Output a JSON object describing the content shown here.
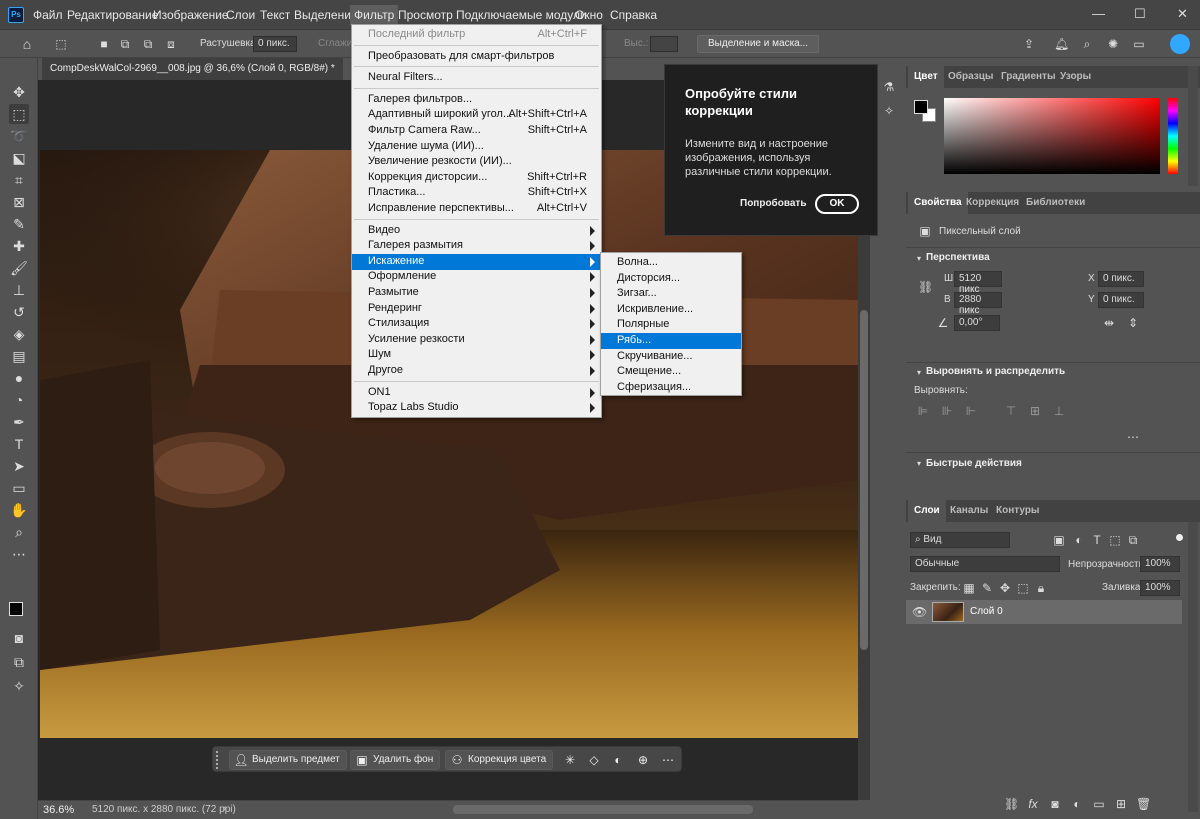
{
  "menubar": {
    "app_icon": "Ps",
    "items": [
      "Файл",
      "Редактирование",
      "Изображение",
      "Слои",
      "Текст",
      "Выделение",
      "Фильтр",
      "Просмотр",
      "Подключаемые модули",
      "Окно",
      "Справка"
    ],
    "active": "Фильтр"
  },
  "options": {
    "feather_label": "Растушевка:",
    "feather_value": "0 пикс.",
    "smooth_label": "Сглажив.",
    "height_label": "Выс.:",
    "select_mask_button": "Выделение и маска..."
  },
  "document": {
    "tab_title": "CompDeskWalCol-2969__008.jpg @ 36,6% (Слой 0, RGB/8#) *",
    "zoom": "36.6%",
    "info": "5120 пикс. x 2880 пикс. (72 ppi)"
  },
  "taskbar": {
    "select_subject": "Выделить предмет",
    "remove_bg": "Удалить фон",
    "color_correction": "Коррекция цвета"
  },
  "filter_menu": {
    "items": [
      {
        "label": "Последний фильтр",
        "shortcut": "Alt+Ctrl+F",
        "disabled": true
      },
      {
        "sep": true
      },
      {
        "label": "Преобразовать для смарт-фильтров"
      },
      {
        "sep": true
      },
      {
        "label": "Neural Filters..."
      },
      {
        "sep": true
      },
      {
        "label": "Галерея фильтров..."
      },
      {
        "label": "Адаптивный широкий угол...",
        "shortcut": "Alt+Shift+Ctrl+A"
      },
      {
        "label": "Фильтр Camera Raw...",
        "shortcut": "Shift+Ctrl+A"
      },
      {
        "label": "Удаление шума (ИИ)..."
      },
      {
        "label": "Увеличение резкости (ИИ)..."
      },
      {
        "label": "Коррекция дисторсии...",
        "shortcut": "Shift+Ctrl+R"
      },
      {
        "label": "Пластика...",
        "shortcut": "Shift+Ctrl+X"
      },
      {
        "label": "Исправление перспективы...",
        "shortcut": "Alt+Ctrl+V"
      },
      {
        "sep": true
      },
      {
        "label": "Видео",
        "sub": true
      },
      {
        "label": "Галерея размытия",
        "sub": true
      },
      {
        "label": "Искажение",
        "sub": true,
        "hl": true
      },
      {
        "label": "Оформление",
        "sub": true
      },
      {
        "label": "Размытие",
        "sub": true
      },
      {
        "label": "Рендеринг",
        "sub": true
      },
      {
        "label": "Стилизация",
        "sub": true
      },
      {
        "label": "Усиление резкости",
        "sub": true
      },
      {
        "label": "Шум",
        "sub": true
      },
      {
        "label": "Другое",
        "sub": true
      },
      {
        "sep": true
      },
      {
        "label": "ON1",
        "sub": true
      },
      {
        "label": "Topaz Labs Studio",
        "sub": true
      }
    ]
  },
  "distort_menu": {
    "items": [
      "Волна...",
      "Дисторсия...",
      "Зигзаг...",
      "Искривление...",
      "Полярные координаты...",
      "Рябь...",
      "Скручивание...",
      "Смещение...",
      "Сферизация..."
    ],
    "highlighted": "Рябь..."
  },
  "card": {
    "title": "Опробуйте стили коррекции",
    "description": "Измените вид и настроение изображения, используя различные стили коррекции.",
    "try_label": "Попробовать",
    "ok_label": "OK"
  },
  "color_panel": {
    "tabs": [
      "Цвет",
      "Образцы",
      "Градиенты",
      "Узоры"
    ]
  },
  "properties_panel": {
    "tabs": [
      "Свойства",
      "Коррекция",
      "Библиотеки"
    ],
    "layer_type": "Пиксельный слой",
    "perspective_title": "Перспектива",
    "w_label": "Ш",
    "w_value": "5120 пикс",
    "h_label": "В",
    "h_value": "2880 пикс",
    "x_label": "X",
    "x_value": "0 пикс.",
    "y_label": "Y",
    "y_value": "0 пикс.",
    "angle_value": "0,00°",
    "align_title": "Выровнять и распределить",
    "align_label": "Выровнять:",
    "quick_actions_title": "Быстрые действия"
  },
  "layers_panel": {
    "tabs": [
      "Слои",
      "Каналы",
      "Контуры"
    ],
    "filter_kind": "Вид",
    "blend_mode": "Обычные",
    "opacity_label": "Непрозрачность:",
    "opacity_value": "100%",
    "lock_label": "Закрепить:",
    "fill_label": "Заливка:",
    "fill_value": "100%",
    "layers": [
      {
        "name": "Слой 0",
        "visible": true
      }
    ]
  },
  "colors": {
    "accent": "#0078d7",
    "ps_blue": "#31a8ff",
    "panel_bg": "#535353"
  }
}
